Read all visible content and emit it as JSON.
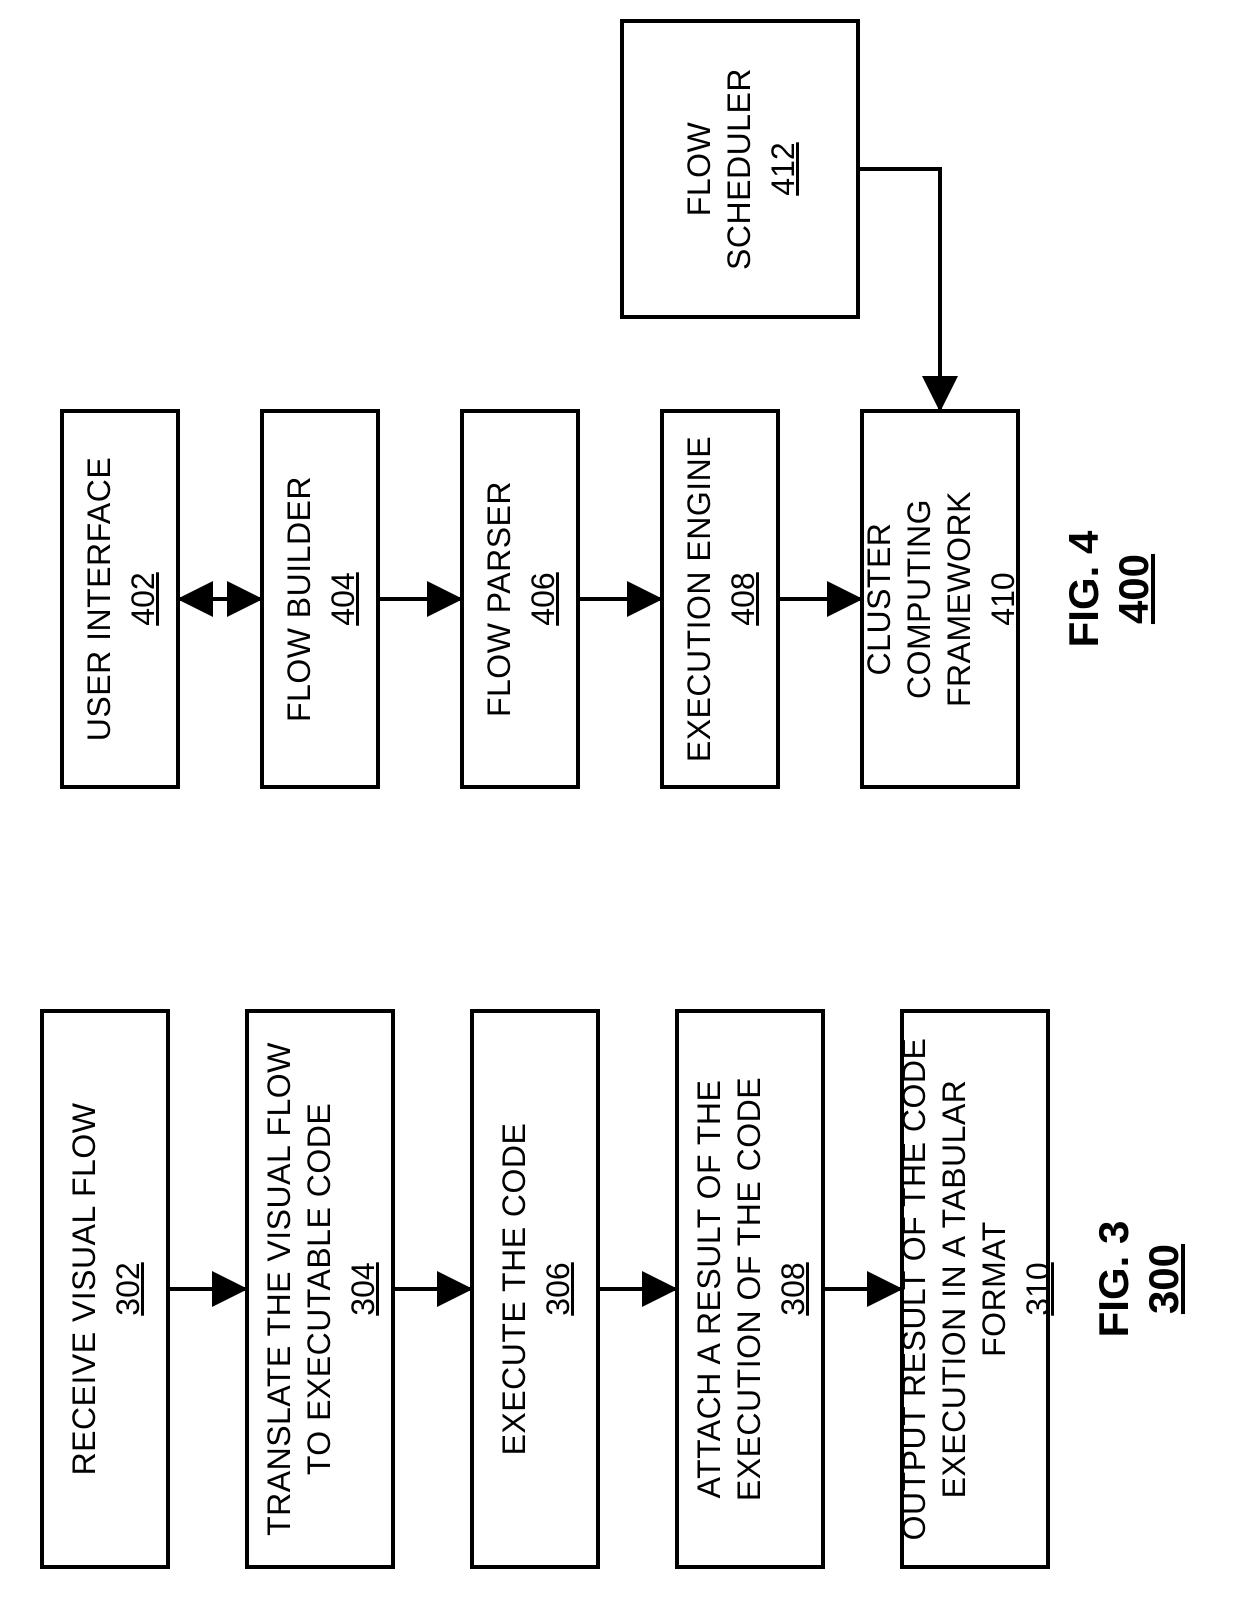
{
  "figure3": {
    "caption_label": "FIG. 3",
    "caption_ref": "300",
    "steps": [
      {
        "title": "RECEIVE VISUAL FLOW",
        "ref": "302"
      },
      {
        "title": "TRANSLATE THE VISUAL FLOW TO EXECUTABLE CODE",
        "ref": "304"
      },
      {
        "title": "EXECUTE THE CODE",
        "ref": "306"
      },
      {
        "title": "ATTACH A RESULT OF THE EXECUTION OF THE CODE",
        "ref": "308"
      },
      {
        "title": "OUTPUT RESULT OF THE CODE EXECUTION IN A TABULAR FORMAT",
        "ref": "310"
      }
    ]
  },
  "figure4": {
    "caption_label": "FIG. 4",
    "caption_ref": "400",
    "blocks": {
      "user_interface": {
        "title": "USER INTERFACE",
        "ref": "402"
      },
      "flow_builder": {
        "title": "FLOW BUILDER",
        "ref": "404"
      },
      "flow_parser": {
        "title": "FLOW PARSER",
        "ref": "406"
      },
      "execution_engine": {
        "title": "EXECUTION ENGINE",
        "ref": "408"
      },
      "cluster": {
        "title": "CLUSTER COMPUTING FRAMEWORK",
        "ref": "410"
      },
      "flow_scheduler": {
        "title": "FLOW SCHEDULER",
        "ref": "412"
      }
    }
  }
}
